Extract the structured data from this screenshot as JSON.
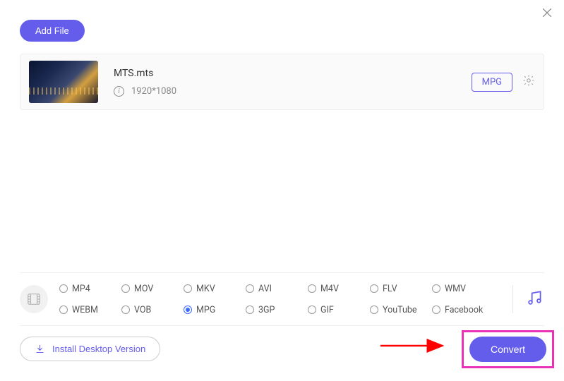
{
  "header": {
    "add_file_label": "Add File"
  },
  "file": {
    "name": "MTS.mts",
    "resolution": "1920*1080",
    "output_format": "MPG"
  },
  "formats": {
    "items": [
      "MP4",
      "MOV",
      "MKV",
      "AVI",
      "M4V",
      "FLV",
      "WMV",
      "WEBM",
      "VOB",
      "MPG",
      "3GP",
      "GIF",
      "YouTube",
      "Facebook"
    ],
    "selected": "MPG"
  },
  "footer": {
    "install_label": "Install Desktop Version",
    "convert_label": "Convert"
  }
}
